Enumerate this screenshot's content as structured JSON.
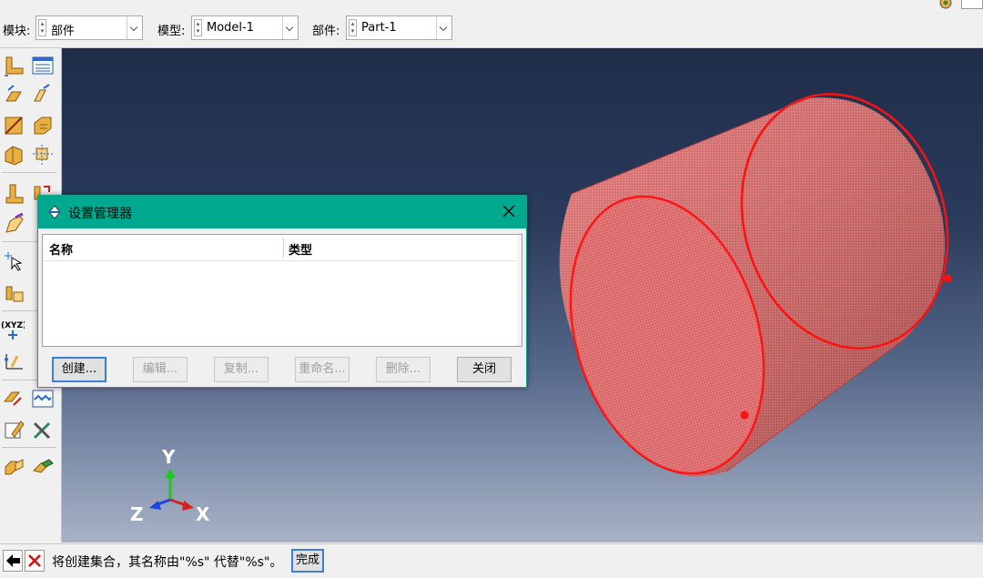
{
  "context_bar": {
    "module": {
      "label": "模块:",
      "value": "部件"
    },
    "model": {
      "label": "模型:",
      "value": "Model-1"
    },
    "part": {
      "label": "部件:",
      "value": "Part-1"
    }
  },
  "toolbox": {
    "icons": [
      "create-part-icon",
      "part-manager-icon",
      "create-solid-extrude-icon",
      "create-shell-icon",
      "create-wire-icon",
      "create-cut-icon",
      "create-round-icon",
      "create-datum-icon",
      "create-partition-icon",
      "query-icon",
      "create-set-icon",
      "select-pointer-icon",
      "create-reference-point-icon",
      "coordinate-xyz-icon",
      "create-datum-axis-icon",
      "create-datum-plane-icon",
      "create-virtual-topology-icon",
      "edit-feature-icon",
      "tools-icon",
      "assembly-instance-icon",
      "replace-part-icon"
    ]
  },
  "viewport": {
    "triad": {
      "y_label": "Y",
      "z_label": "Z",
      "x_label": "X"
    },
    "part_color": "#e06a6a",
    "edge_color": "#ff0000"
  },
  "dialog": {
    "title": "设置管理器",
    "columns": [
      "名称",
      "类型"
    ],
    "rows": [],
    "buttons": {
      "create": "创建...",
      "edit": "编辑...",
      "copy": "复制...",
      "rename": "重命名...",
      "delete": "删除...",
      "close": "关闭"
    }
  },
  "prompt": {
    "message": "将创建集合，其名称由\"%s\" 代替\"%s\"。",
    "done_label": "完成"
  },
  "colors": {
    "dialog_titlebar": "#00a88f",
    "viewport_top": "#1f2d49",
    "viewport_bottom": "#a7b2c6"
  }
}
